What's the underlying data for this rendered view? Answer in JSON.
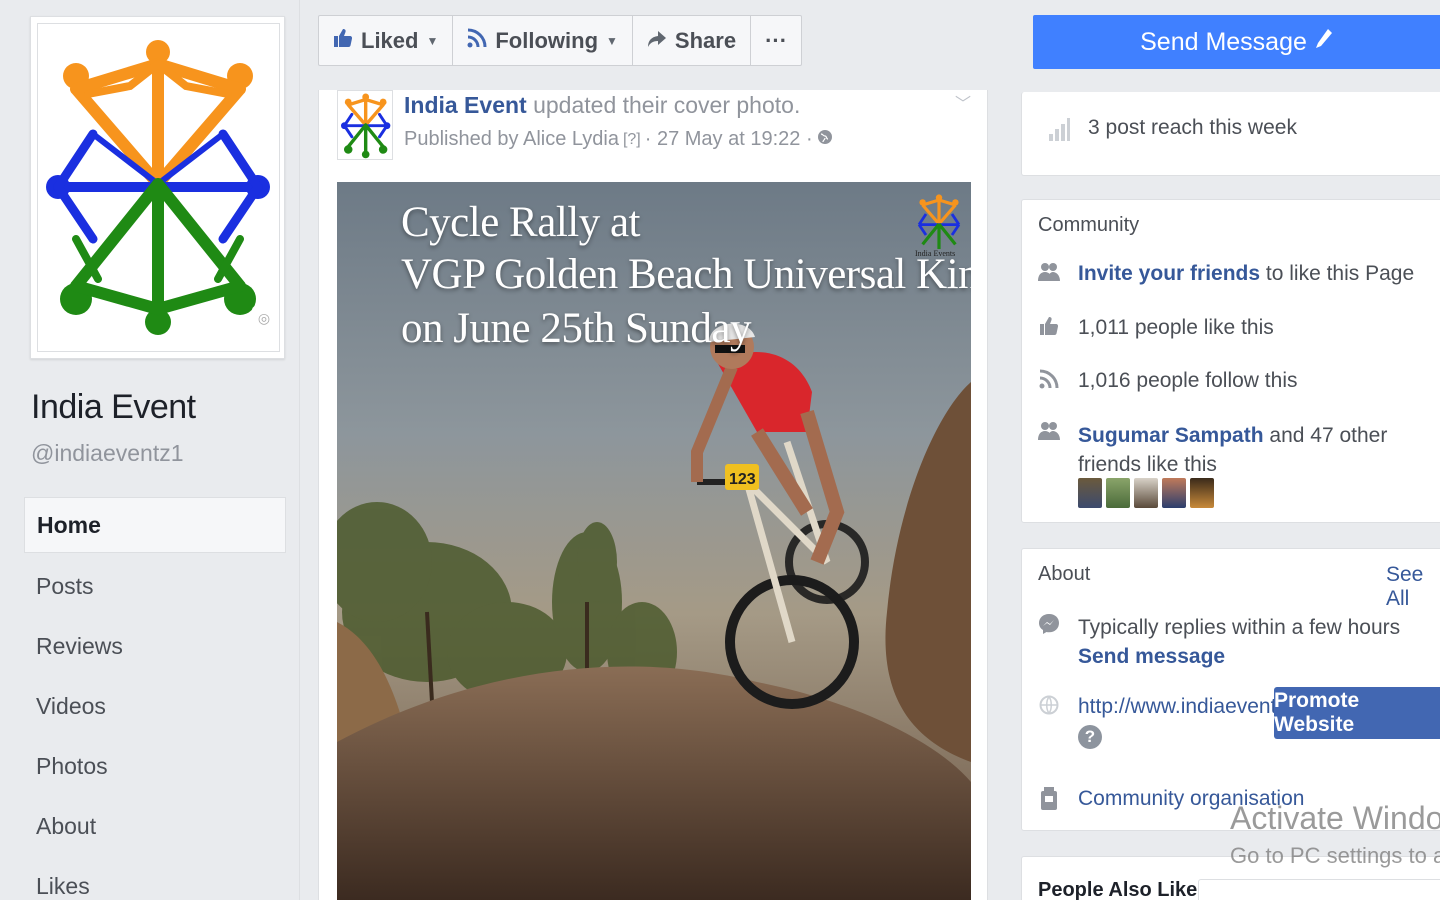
{
  "page": {
    "name": "India Event",
    "handle": "@indiaeventz1"
  },
  "nav": {
    "items": [
      {
        "label": "Home",
        "active": true
      },
      {
        "label": "Posts"
      },
      {
        "label": "Reviews"
      },
      {
        "label": "Videos"
      },
      {
        "label": "Photos"
      },
      {
        "label": "About"
      },
      {
        "label": "Likes"
      }
    ]
  },
  "action_bar": {
    "liked": "Liked",
    "following": "Following",
    "share": "Share",
    "more": "···"
  },
  "send_message": {
    "label": "Send Message"
  },
  "post": {
    "author": "India Event",
    "action": "updated their cover photo.",
    "published_by": "Published by Alice Lydia",
    "help_marker": "[?]",
    "time": "· 27 May at 19:22 ·",
    "cover": {
      "line1": "Cycle Rally  at",
      "line2": "VGP Golden Beach Universal Kingdom",
      "line3": "on June 25th Sunday",
      "logo_caption": "India Events",
      "bib_number": "123"
    }
  },
  "reach": {
    "text": "3 post reach this week"
  },
  "community": {
    "title": "Community",
    "invite_link": "Invite your friends",
    "invite_rest": "to like this Page",
    "likes": "1,011 people like this",
    "follows": "1,016 people follow this",
    "friend_name": "Sugumar Sampath",
    "friends_rest": "and 47 other friends like",
    "friends_rest2": "this"
  },
  "about": {
    "title": "About",
    "see_all": "See All",
    "replies": "Typically replies within a few hours",
    "send_message_link": "Send message",
    "website": "http://www.indiaevent...",
    "promote": "Promote Website",
    "help": "?",
    "category": "Community organisation"
  },
  "people_also_like": {
    "title": "People Also Like"
  },
  "watermark": {
    "title": "Activate Windows",
    "subtitle": "Go to PC settings to activ"
  },
  "colors": {
    "brand_blue": "#4080ff",
    "link_blue": "#365899",
    "promote_blue": "#4267b2",
    "logo_orange": "#f7941d",
    "logo_blue": "#1a2fe0",
    "logo_green": "#1f8a14"
  },
  "icons": {
    "liked": "thumbs-up-icon",
    "following": "rss-icon",
    "share": "share-arrow-icon",
    "send_message": "pencil-icon",
    "reach": "bar-chart-icon",
    "invite": "people-icon",
    "likes": "thumbs-up-icon",
    "follows": "rss-icon",
    "friends": "people-icon",
    "replies": "messenger-icon",
    "website": "globe-icon",
    "category": "building-icon",
    "privacy": "globe-icon"
  }
}
